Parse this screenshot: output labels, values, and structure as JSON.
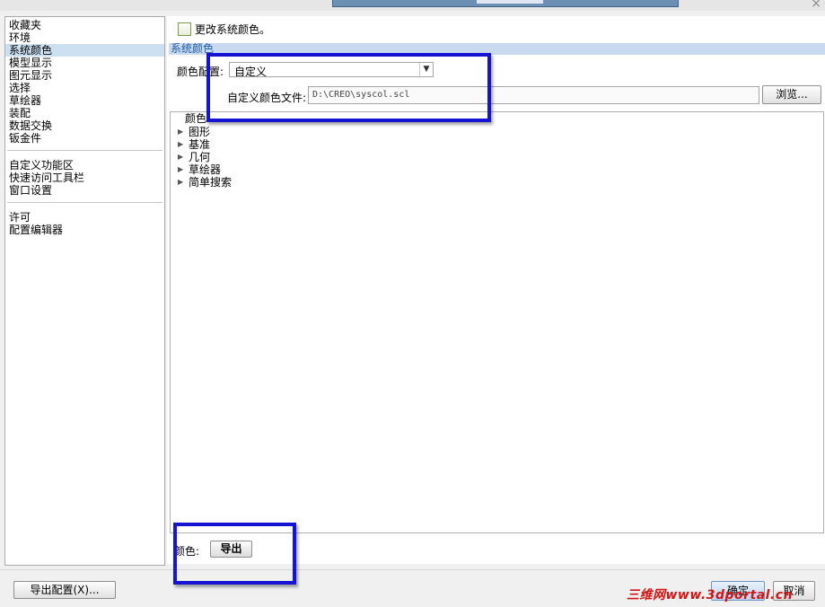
{
  "window": {
    "close_icon": "close-icon",
    "title_bar_color": "#6c8fb4"
  },
  "sidebar": {
    "groups": [
      {
        "items": [
          {
            "label": "收藏夹"
          },
          {
            "label": "环境"
          },
          {
            "label": "系统颜色",
            "selected": true
          },
          {
            "label": "模型显示"
          },
          {
            "label": "图元显示"
          },
          {
            "label": "选择"
          },
          {
            "label": "草绘器"
          },
          {
            "label": "装配"
          },
          {
            "label": "数据交换"
          },
          {
            "label": "钣金件"
          }
        ]
      },
      {
        "items": [
          {
            "label": "自定义功能区"
          },
          {
            "label": "快速访问工具栏"
          },
          {
            "label": "窗口设置"
          }
        ]
      },
      {
        "items": [
          {
            "label": "许可"
          },
          {
            "label": "配置编辑器"
          }
        ]
      }
    ]
  },
  "main": {
    "change_colors_checkbox": {
      "label": "更改系统颜色。",
      "checked": false
    },
    "section_title": "系统颜色",
    "scheme": {
      "label": "颜色配置:",
      "value": "自定义"
    },
    "file": {
      "label": "自定义颜色文件:",
      "value": "D:\\CREO\\syscol.scl",
      "browse_label": "浏览..."
    },
    "tree": {
      "header": "颜色",
      "items": [
        {
          "label": "图形"
        },
        {
          "label": "基准"
        },
        {
          "label": "几何"
        },
        {
          "label": "草绘器"
        },
        {
          "label": "简单搜索"
        }
      ]
    },
    "color_label": "颜色:",
    "export_label": "导出"
  },
  "footer": {
    "export_config_label": "导出配置(X)...",
    "ok_label": "确定",
    "cancel_label": "取消"
  },
  "watermark": {
    "text": "三维网www.3dportal.cn",
    "color": "#d31414"
  },
  "annotation_color": "#1414d2",
  "selection_color": "#cde0f2"
}
